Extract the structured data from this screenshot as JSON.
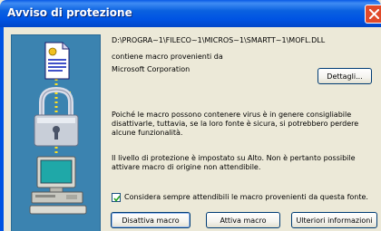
{
  "window": {
    "title": "Avviso di protezione"
  },
  "file": {
    "path": "D:\\PROGRA~1\\FILECO~1\\MICROS~1\\SMARTT~1\\MOFL.DLL",
    "contains_text": "contiene macro provenienti da",
    "publisher": "Microsoft Corporation"
  },
  "details_button": {
    "label": "Dettagli..."
  },
  "messages": {
    "virus_warning": "Poiché le macro possono contenere virus è in genere consigliabile disattivarle, tuttavia, se la loro fonte è sicura, si potrebbero perdere alcune funzionalità.",
    "security_level": "Il livello di protezione è impostato su Alto. Non è pertanto possibile attivare macro di origine non attendibile."
  },
  "trust_checkbox": {
    "label": "Considera sempre attendibili le macro provenienti da questa fonte.",
    "checked": true
  },
  "buttons": {
    "disable_label": "Disattiva macro",
    "enable_label": "Attiva macro",
    "more_info_label": "Ulteriori informazioni"
  },
  "icons": {
    "close": "close-icon",
    "document": "document-icon",
    "padlock": "padlock-icon",
    "computer": "computer-icon"
  },
  "colors": {
    "titlebar": "#0054e3",
    "dialog_bg": "#ece9d8",
    "left_pane": "#3b83b0",
    "close_button": "#e04a2a",
    "button_border": "#003c74"
  }
}
